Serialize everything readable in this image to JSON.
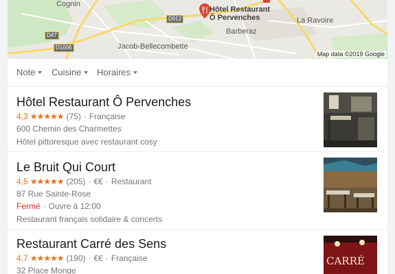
{
  "map": {
    "labels": {
      "cognin": "Cognin",
      "jacob": "Jacob-Bellecombette",
      "barberaz": "Barberaz",
      "la_ravoire": "La Ravoire"
    },
    "roads": {
      "d912": "D912",
      "d47": "D47",
      "d1006": "D1006"
    },
    "pin_name_line1": "Hôtel Restaurant",
    "pin_name_line2": "Ô Pervenches",
    "attribution": "Map data ©2019 Google"
  },
  "filters": [
    "Note",
    "Cuisine",
    "Horaires"
  ],
  "listings": [
    {
      "name": "Hôtel Restaurant Ô Pervenches",
      "rating": "4,3",
      "stars": "★★★★★",
      "reviews": "(75)",
      "category": "Française",
      "address": "600 Chemin des Charmettes",
      "description": "Hôtel pittoresque avec restaurant cosy"
    },
    {
      "name": "Le Bruit Qui Court",
      "rating": "4,5",
      "stars": "★★★★★",
      "reviews": "(205)",
      "price": "€€",
      "category": "Restaurant",
      "address": "87 Rue Sainte-Rose",
      "status": "Fermé",
      "hours": "Ouvre à 12:00",
      "description": "Restaurant français solidaire & concerts"
    },
    {
      "name": "Restaurant Carré des Sens",
      "rating": "4,7",
      "stars": "★★★★★",
      "reviews": "(190)",
      "price": "€€",
      "category": "Française",
      "address": "32 Place Monge",
      "sign_text": "CARRÉ"
    }
  ],
  "colors": {
    "star": "#e7711b",
    "closed": "#d93025",
    "pin": "#db4437"
  }
}
